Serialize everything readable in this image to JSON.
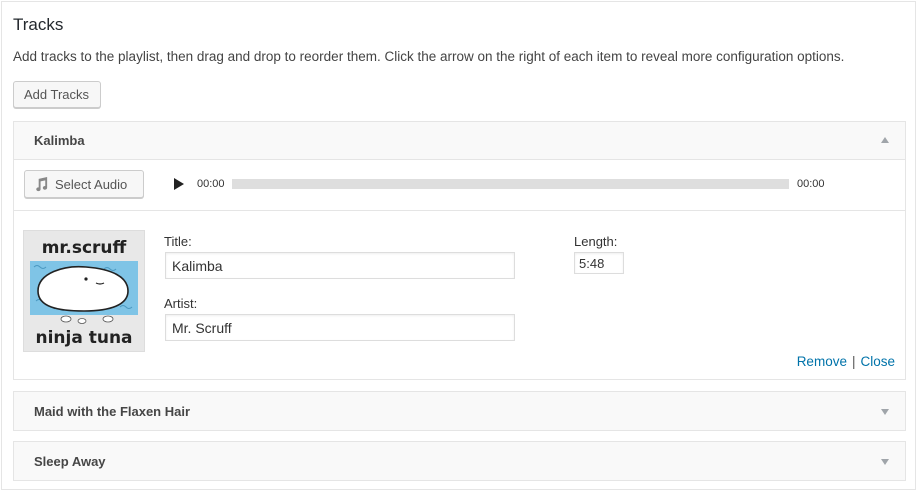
{
  "panel": {
    "title": "Tracks",
    "description": "Add tracks to the playlist, then drag and drop to reorder them. Click the arrow on the right of each item to reveal more configuration options.",
    "add_button": "Add Tracks"
  },
  "tracks": [
    {
      "name": "Kalimba",
      "expanded": true,
      "select_audio_label": "Select Audio",
      "current_time": "00:00",
      "duration_display": "00:00",
      "progress": 0,
      "cover": {
        "top_text": "mr.scruff",
        "bottom_text": "ninja tuna"
      },
      "title_label": "Title:",
      "title_value": "Kalimba",
      "artist_label": "Artist:",
      "artist_value": "Mr. Scruff",
      "length_label": "Length:",
      "length_value": "5:48",
      "remove_label": "Remove",
      "separator": "|",
      "close_label": "Close"
    },
    {
      "name": "Maid with the Flaxen Hair",
      "expanded": false
    },
    {
      "name": "Sleep Away",
      "expanded": false
    }
  ],
  "icons": {
    "music_note": "music-note-icon",
    "play": "play-icon",
    "collapse": "arrow-up-icon",
    "expand": "arrow-down-icon"
  },
  "colors": {
    "link": "#0073aa",
    "header_bg": "#f9f9f9",
    "border": "#e5e5e5",
    "cover_water": "#7fc4e6"
  }
}
